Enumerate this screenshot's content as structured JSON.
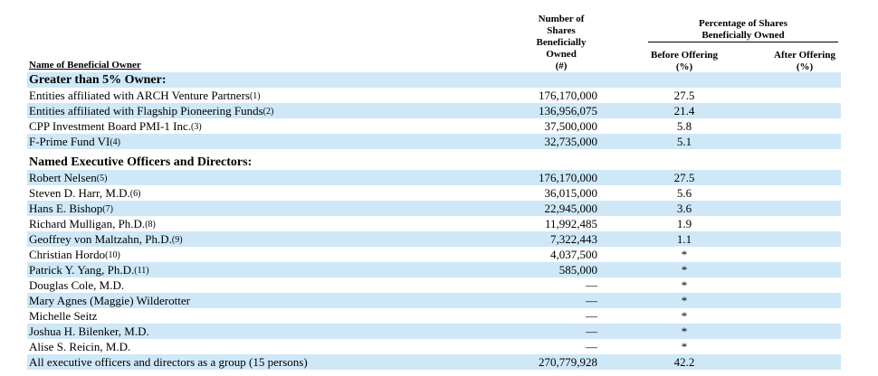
{
  "headers": {
    "name": "Name of Beneficial Owner",
    "shares_lines": [
      "Number of",
      "Shares",
      "Beneficially",
      "Owned",
      "(#)"
    ],
    "pct_group_lines": [
      "Percentage of Shares",
      "Beneficially Owned"
    ],
    "before_lines": [
      "Before Offering",
      "(%)"
    ],
    "after_lines": [
      "After Offering",
      "(%)"
    ]
  },
  "rows": [
    {
      "name": "Greater than 5% Owner:",
      "note": "",
      "shares": "",
      "before": "",
      "after": "",
      "section": true,
      "shaded": true
    },
    {
      "name": "Entities affiliated with ARCH Venture Partners",
      "note": "(1)",
      "shares": "176,170,000",
      "before": "27.5",
      "after": "",
      "shaded": false
    },
    {
      "name": "Entities affiliated with Flagship Pioneering Funds",
      "note": "(2)",
      "shares": "136,956,075",
      "before": "21.4",
      "after": "",
      "shaded": true
    },
    {
      "name": "CPP Investment Board PMI-1 Inc.",
      "note": "(3)",
      "shares": "37,500,000",
      "before": "5.8",
      "after": "",
      "shaded": false
    },
    {
      "name": "F-Prime Fund VI",
      "note": "(4)",
      "shares": "32,735,000",
      "before": "5.1",
      "after": "",
      "shaded": true
    },
    {
      "name": "Named Executive Officers and Directors:",
      "note": "",
      "shares": "",
      "before": "",
      "after": "",
      "section": true,
      "shaded": false
    },
    {
      "name": "Robert Nelsen",
      "note": "(5)",
      "shares": "176,170,000",
      "before": "27.5",
      "after": "",
      "shaded": true
    },
    {
      "name": "Steven D. Harr, M.D.",
      "note": "(6)",
      "shares": "36,015,000",
      "before": "5.6",
      "after": "",
      "shaded": false
    },
    {
      "name": "Hans E. Bishop",
      "note": "(7)",
      "shares": "22,945,000",
      "before": "3.6",
      "after": "",
      "shaded": true
    },
    {
      "name": "Richard Mulligan, Ph.D.",
      "note": "(8)",
      "shares": "11,992,485",
      "before": "1.9",
      "after": "",
      "shaded": false
    },
    {
      "name": "Geoffrey von Maltzahn, Ph.D.",
      "note": "(9)",
      "shares": "7,322,443",
      "before": "1.1",
      "after": "",
      "shaded": true
    },
    {
      "name": "Christian Hordo",
      "note": "(10)",
      "shares": "4,037,500",
      "before": "*",
      "after": "",
      "shaded": false
    },
    {
      "name": "Patrick Y. Yang, Ph.D.",
      "note": "(11)",
      "shares": "585,000",
      "before": "*",
      "after": "",
      "shaded": true
    },
    {
      "name": "Douglas Cole, M.D.",
      "note": "",
      "shares": "—",
      "before": "*",
      "after": "",
      "shaded": false
    },
    {
      "name": "Mary Agnes (Maggie) Wilderotter",
      "note": "",
      "shares": "—",
      "before": "*",
      "after": "",
      "shaded": true
    },
    {
      "name": "Michelle Seitz",
      "note": "",
      "shares": "—",
      "before": "*",
      "after": "",
      "shaded": false
    },
    {
      "name": "Joshua H. Bilenker, M.D.",
      "note": "",
      "shares": "—",
      "before": "*",
      "after": "",
      "shaded": true
    },
    {
      "name": "Alise S. Reicin, M.D.",
      "note": "",
      "shares": "—",
      "before": "*",
      "after": "",
      "shaded": false
    },
    {
      "name": "All executive officers and directors as a group (15 persons)",
      "note": "",
      "shares": "270,779,928",
      "before": "42.2",
      "after": "",
      "shaded": true
    }
  ]
}
